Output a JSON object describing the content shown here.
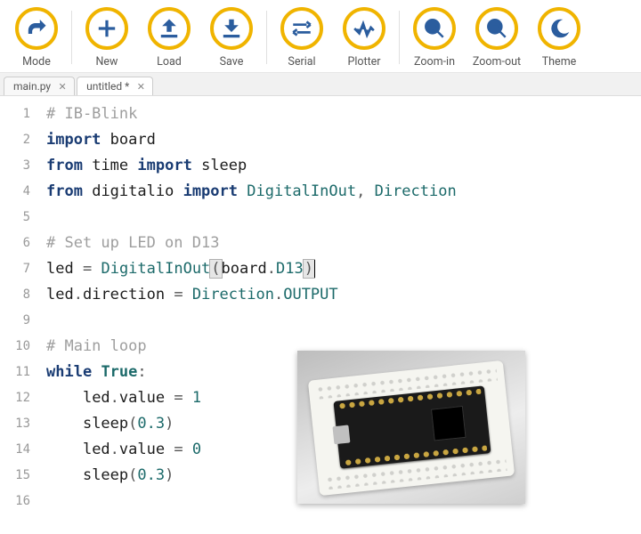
{
  "toolbar": {
    "mode": {
      "label": "Mode",
      "icon": "mode-icon"
    },
    "new": {
      "label": "New",
      "icon": "plus-icon"
    },
    "load": {
      "label": "Load",
      "icon": "load-icon"
    },
    "save": {
      "label": "Save",
      "icon": "save-icon"
    },
    "serial": {
      "label": "Serial",
      "icon": "serial-icon"
    },
    "plotter": {
      "label": "Plotter",
      "icon": "plotter-icon"
    },
    "zoomin": {
      "label": "Zoom-in",
      "icon": "zoom-in-icon"
    },
    "zoomout": {
      "label": "Zoom-out",
      "icon": "zoom-out-icon"
    },
    "theme": {
      "label": "Theme",
      "icon": "theme-icon"
    }
  },
  "tabs": [
    {
      "label": "main.py",
      "dirty": false,
      "active": false
    },
    {
      "label": "untitled *",
      "dirty": true,
      "active": true
    }
  ],
  "code": {
    "lines": [
      {
        "n": 1,
        "tokens": [
          [
            "com",
            "# IB-Blink"
          ]
        ]
      },
      {
        "n": 2,
        "tokens": [
          [
            "kw",
            "import"
          ],
          [
            "sp",
            " "
          ],
          [
            "name",
            "board"
          ]
        ]
      },
      {
        "n": 3,
        "tokens": [
          [
            "kw",
            "from"
          ],
          [
            "sp",
            " "
          ],
          [
            "name",
            "time"
          ],
          [
            "sp",
            " "
          ],
          [
            "kw",
            "import"
          ],
          [
            "sp",
            " "
          ],
          [
            "name",
            "sleep"
          ]
        ]
      },
      {
        "n": 4,
        "tokens": [
          [
            "kw",
            "from"
          ],
          [
            "sp",
            " "
          ],
          [
            "name",
            "digitalio"
          ],
          [
            "sp",
            " "
          ],
          [
            "kw",
            "import"
          ],
          [
            "sp",
            " "
          ],
          [
            "cls",
            "DigitalInOut"
          ],
          [
            "punc",
            ","
          ],
          [
            "sp",
            " "
          ],
          [
            "cls",
            "Direction"
          ]
        ]
      },
      {
        "n": 5,
        "tokens": []
      },
      {
        "n": 6,
        "tokens": [
          [
            "com",
            "# Set up LED on D13"
          ]
        ]
      },
      {
        "n": 7,
        "tokens": [
          [
            "name",
            "led"
          ],
          [
            "sp",
            " "
          ],
          [
            "punc",
            "="
          ],
          [
            "sp",
            " "
          ],
          [
            "cls",
            "DigitalInOut"
          ],
          [
            "hl-open",
            "("
          ],
          [
            "name",
            "board"
          ],
          [
            "punc",
            "."
          ],
          [
            "attr",
            "D13"
          ],
          [
            "hl-close",
            ")"
          ],
          [
            "caret",
            ""
          ]
        ]
      },
      {
        "n": 8,
        "tokens": [
          [
            "name",
            "led"
          ],
          [
            "punc",
            "."
          ],
          [
            "name",
            "direction"
          ],
          [
            "sp",
            " "
          ],
          [
            "punc",
            "="
          ],
          [
            "sp",
            " "
          ],
          [
            "cls",
            "Direction"
          ],
          [
            "punc",
            "."
          ],
          [
            "attr",
            "OUTPUT"
          ]
        ]
      },
      {
        "n": 9,
        "tokens": []
      },
      {
        "n": 10,
        "tokens": [
          [
            "com",
            "# Main loop"
          ]
        ]
      },
      {
        "n": 11,
        "tokens": [
          [
            "kw",
            "while"
          ],
          [
            "sp",
            " "
          ],
          [
            "builtin",
            "True"
          ],
          [
            "punc",
            ":"
          ]
        ]
      },
      {
        "n": 12,
        "tokens": [
          [
            "sp",
            "    "
          ],
          [
            "name",
            "led"
          ],
          [
            "punc",
            "."
          ],
          [
            "name",
            "value"
          ],
          [
            "sp",
            " "
          ],
          [
            "punc",
            "="
          ],
          [
            "sp",
            " "
          ],
          [
            "num",
            "1"
          ]
        ]
      },
      {
        "n": 13,
        "tokens": [
          [
            "sp",
            "    "
          ],
          [
            "name",
            "sleep"
          ],
          [
            "punc",
            "("
          ],
          [
            "num",
            "0.3"
          ],
          [
            "punc",
            ")"
          ]
        ]
      },
      {
        "n": 14,
        "tokens": [
          [
            "sp",
            "    "
          ],
          [
            "name",
            "led"
          ],
          [
            "punc",
            "."
          ],
          [
            "name",
            "value"
          ],
          [
            "sp",
            " "
          ],
          [
            "punc",
            "="
          ],
          [
            "sp",
            " "
          ],
          [
            "num",
            "0"
          ]
        ]
      },
      {
        "n": 15,
        "tokens": [
          [
            "sp",
            "    "
          ],
          [
            "name",
            "sleep"
          ],
          [
            "punc",
            "("
          ],
          [
            "num",
            "0.3"
          ],
          [
            "punc",
            ")"
          ]
        ]
      },
      {
        "n": 16,
        "tokens": []
      }
    ]
  },
  "overlay": {
    "description": "microcontroller-board-photo"
  }
}
